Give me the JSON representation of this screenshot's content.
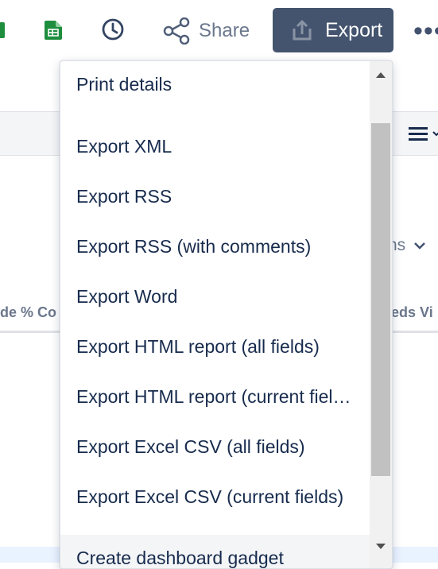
{
  "toolbar": {
    "share_label": "Share",
    "export_label": "Export",
    "more_label": "•••"
  },
  "background": {
    "columns_dropdown_label": "ns",
    "column_header_left": "de %   Co",
    "column_header_right": "eds Vi"
  },
  "export_menu": {
    "items": [
      {
        "label": "Print details"
      },
      {
        "label": "Export XML"
      },
      {
        "label": "Export RSS"
      },
      {
        "label": "Export RSS (with comments)"
      },
      {
        "label": "Export Word"
      },
      {
        "label": "Export HTML report (all fields)"
      },
      {
        "label": "Export HTML report (current fields)"
      },
      {
        "label": "Export Excel CSV (all fields)"
      },
      {
        "label": "Export Excel CSV (current fields)"
      },
      {
        "label": "Create dashboard gadget"
      }
    ]
  },
  "colors": {
    "export_button_bg": "#44546f",
    "text_primary": "#172b4d",
    "text_muted": "#6b778c",
    "sheets_green": "#1e8e3e"
  },
  "icons": [
    "google-sheets-icon",
    "clock-icon",
    "share-icon",
    "export-upload-icon",
    "more-icon",
    "list-view-icon",
    "chevron-down-icon",
    "scroll-up-arrow-icon",
    "scroll-down-arrow-icon"
  ]
}
